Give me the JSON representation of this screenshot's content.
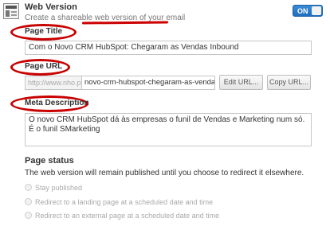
{
  "web_version": {
    "title": "Web Version",
    "desc_plain": "Create a shareable ",
    "desc_highlight": "web version of your email",
    "toggle_label": "ON"
  },
  "page_title": {
    "label": "Page Title",
    "value": "Com o Novo CRM HubSpot: Chegaram as Vendas Inbound"
  },
  "page_url": {
    "label": "Page URL",
    "prefix": "http://www.nho.pt",
    "slug": "novo-crm-hubspot-chegaram-as-vendas-in",
    "edit_button": "Edit URL...",
    "copy_button": "Copy URL..."
  },
  "meta_description": {
    "label": "Meta Description",
    "value": "O novo CRM HubSpot dá às empresas o funil de Vendas e Marketing num só. É o funil SMarketing"
  },
  "page_status": {
    "title": "Page status",
    "description": "The web version will remain published until you choose to redirect it elsewhere.",
    "options": [
      {
        "label": "Stay published"
      },
      {
        "label": "Redirect to a landing page at a scheduled date and time"
      },
      {
        "label": "Redirect to an external page at a scheduled date and time"
      }
    ]
  },
  "colors": {
    "accent": "#1f6fbf",
    "annotation": "#c80000"
  }
}
